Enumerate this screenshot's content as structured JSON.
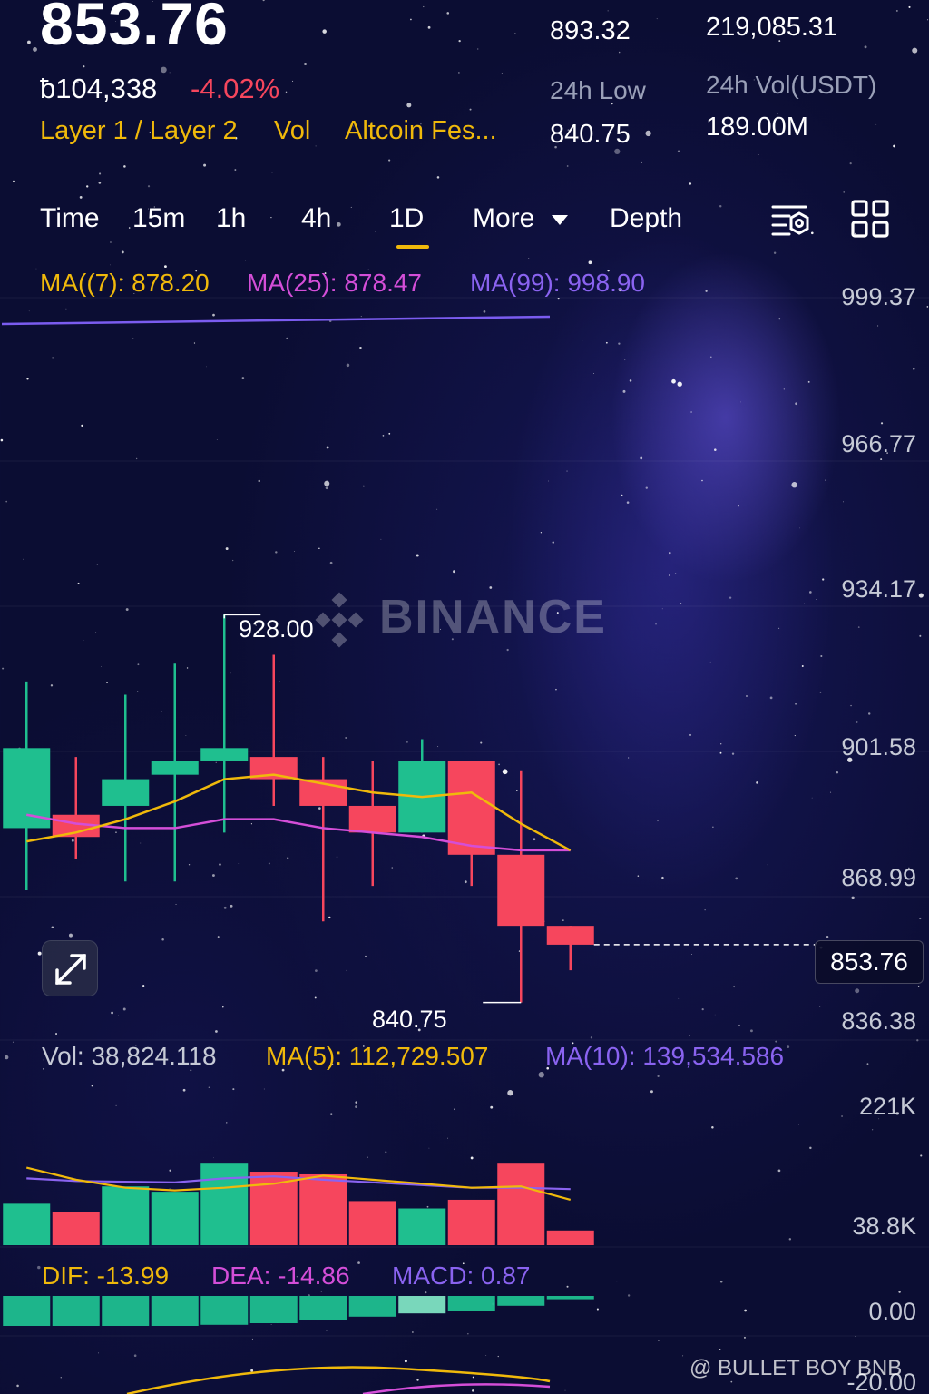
{
  "header": {
    "last_price": "853.76",
    "fiat_price": "ƀ104,338",
    "change_pct": "-4.02%",
    "tags": [
      "Layer 1 / Layer 2",
      "Vol",
      "Altcoin Fes..."
    ],
    "stats": {
      "high_value": "893.32",
      "vol_base_value": "219,085.31",
      "low_label": "24h Low",
      "low_value": "840.75",
      "vol_quote_label": "24h Vol(USDT)",
      "vol_quote_value": "189.00M"
    }
  },
  "timeframes": {
    "items": [
      "Time",
      "15m",
      "1h",
      "4h",
      "1D",
      "More",
      "Depth"
    ],
    "active": "1D"
  },
  "icons": {
    "settings": "chart-settings-icon",
    "layout": "grid-layout-icon",
    "more_caret": "caret-down-icon",
    "expand": "expand-icon"
  },
  "colors": {
    "up": "#1fbf8f",
    "down": "#f6465d",
    "accent": "#f0b90b",
    "ma7": "#f0b90b",
    "ma25": "#d44ed8",
    "ma99": "#8a63f0"
  },
  "ma_legend": {
    "ma7": "MA((7): 878.20",
    "ma25": "MA(25): 878.47",
    "ma99": "MA(99): 998.90"
  },
  "price_axis": [
    "999.37",
    "966.77",
    "934.17",
    "901.58",
    "868.99",
    "853.76",
    "836.38"
  ],
  "high_marker": "928.00",
  "low_marker": "840.75",
  "watermark": "BINANCE",
  "vol_legend": {
    "vol": "Vol: 38,824.118",
    "ma5": "MA(5): 112,729.507",
    "ma10": "MA(10): 139,534.586"
  },
  "vol_axis": [
    "221K",
    "38.8K"
  ],
  "macd_legend": {
    "dif": "DIF: -13.99",
    "dea": "DEA: -14.86",
    "macd": "MACD: 0.87"
  },
  "macd_axis": [
    "0.00",
    "-20.00"
  ],
  "credit": "@ BULLET BOY BNB",
  "chart_data": {
    "type": "candlestick",
    "ylim": [
      836.38,
      999.37
    ],
    "candles": [
      {
        "o": 880,
        "c": 898,
        "h": 913,
        "l": 866
      },
      {
        "o": 883,
        "c": 878,
        "h": 896,
        "l": 873
      },
      {
        "o": 885,
        "c": 891,
        "h": 910,
        "l": 868
      },
      {
        "o": 892,
        "c": 895,
        "h": 917,
        "l": 868
      },
      {
        "o": 895,
        "c": 898,
        "h": 928.0,
        "l": 879
      },
      {
        "o": 896,
        "c": 891,
        "h": 919,
        "l": 885
      },
      {
        "o": 891,
        "c": 885,
        "h": 896,
        "l": 859
      },
      {
        "o": 885,
        "c": 879,
        "h": 895,
        "l": 867
      },
      {
        "o": 879,
        "c": 895,
        "h": 900,
        "l": 879
      },
      {
        "o": 895,
        "c": 874,
        "h": 895,
        "l": 867
      },
      {
        "o": 874,
        "c": 858,
        "h": 893,
        "l": 840.75
      },
      {
        "o": 858,
        "c": 853.76,
        "h": 858,
        "l": 848
      }
    ],
    "ma7": [
      877,
      879,
      882,
      886,
      891,
      892,
      890,
      888,
      887,
      888,
      881,
      875
    ],
    "ma25": [
      883,
      881,
      880,
      880,
      882,
      882,
      880,
      879,
      878,
      876,
      875,
      875
    ],
    "volume": {
      "ylim": [
        38800,
        221000
      ],
      "bars": [
        62000,
        50000,
        88000,
        80000,
        122000,
        110000,
        106000,
        66000,
        55000,
        68000,
        122000,
        22000
      ],
      "ma5": [
        116000,
        98000,
        86000,
        82000,
        86000,
        92000,
        104000,
        98000,
        92000,
        86000,
        88000,
        68000
      ],
      "ma10": [
        100000,
        96000,
        95000,
        94000,
        100000,
        103000,
        98000,
        94000,
        90000,
        86000,
        86000,
        84000
      ]
    },
    "macd": {
      "ylim": [
        -20,
        0
      ],
      "hist": [
        -5.5,
        -5.5,
        -5.5,
        -5.5,
        -5.3,
        -5.0,
        -4.4,
        -3.8,
        -3.2,
        -2.8,
        -1.8,
        -0.6
      ]
    }
  }
}
